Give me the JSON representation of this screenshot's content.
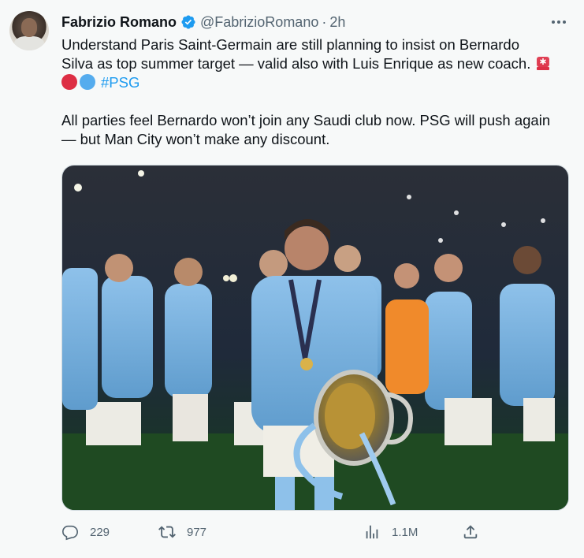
{
  "tweet": {
    "author_name": "Fabrizio Romano",
    "handle": "@FabrizioRomano",
    "separator": "·",
    "time": "2h",
    "text_line1": "Understand Paris Saint-Germain are still planning to insist on Bernardo",
    "text_line2": "Silva as top summer target — valid also with Luis Enrique as new coach.",
    "hashtag": "#PSG",
    "text_line4": "All parties feel Bernardo won’t join any Saudi club now. PSG will push again",
    "text_line5": "— but Man City won’t make any discount.",
    "media_description_icon": "photo-man-city-champions-league-trophy-celebration"
  },
  "actions": {
    "replies": "229",
    "retweets": "977",
    "views": "1.1M"
  },
  "colors": {
    "background": "#f7f9f9",
    "text": "#0f1419",
    "secondary": "#536471",
    "accent": "#1d9bf0",
    "verified": "#1d9bf0",
    "red_circle": "#dd2e44",
    "blue_circle": "#55acee"
  },
  "icons": {
    "more": "more-horizontal-icon",
    "reply": "reply-icon",
    "retweet": "retweet-icon",
    "views": "analytics-icon",
    "share": "share-icon",
    "siren": "rotating-light-emoji"
  }
}
